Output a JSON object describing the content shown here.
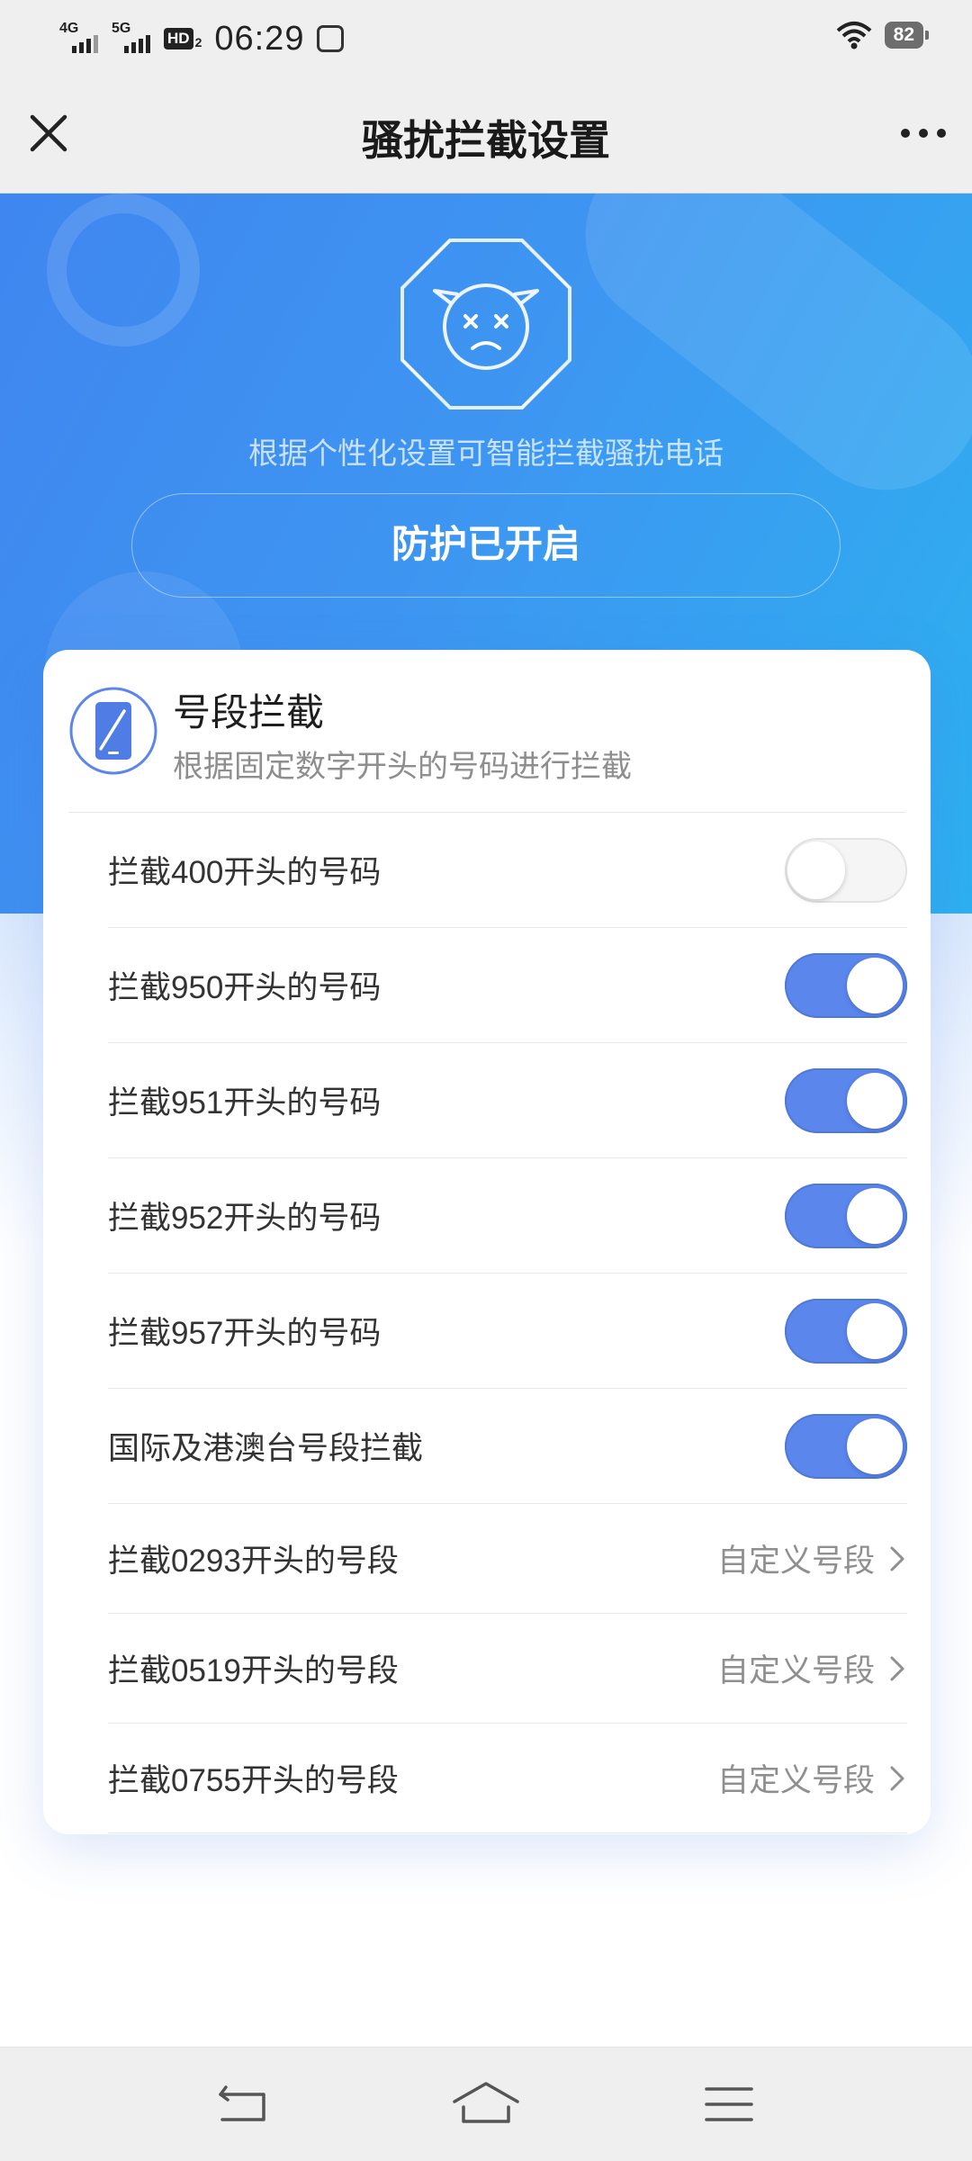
{
  "status_bar": {
    "network_1": "4G",
    "network_2": "5G",
    "hd_badge": "HD",
    "hd_sub": "2",
    "time": "06:29",
    "battery": "82"
  },
  "header": {
    "title": "骚扰拦截设置"
  },
  "hero": {
    "description": "根据个性化设置可智能拦截骚扰电话",
    "status_button": "防护已开启"
  },
  "card": {
    "title": "号段拦截",
    "subtitle": "根据固定数字开头的号码进行拦截",
    "toggle_rows": [
      {
        "label": "拦截400开头的号码",
        "enabled": false
      },
      {
        "label": "拦截950开头的号码",
        "enabled": true
      },
      {
        "label": "拦截951开头的号码",
        "enabled": true
      },
      {
        "label": "拦截952开头的号码",
        "enabled": true
      },
      {
        "label": "拦截957开头的号码",
        "enabled": true
      },
      {
        "label": "国际及港澳台号段拦截",
        "enabled": true
      }
    ],
    "link_rows": [
      {
        "label": "拦截0293开头的号段",
        "action": "自定义号段"
      },
      {
        "label": "拦截0519开头的号段",
        "action": "自定义号段"
      },
      {
        "label": "拦截0755开头的号段",
        "action": "自定义号段"
      }
    ]
  },
  "colors": {
    "hero_gradient_start": "#3f86f0",
    "hero_gradient_end": "#2db0f0",
    "toggle_on": "#5b86ec",
    "icon_outline": "#5b86ec"
  },
  "icons": {
    "close": "close-icon",
    "more": "more-dots-icon",
    "emblem": "angry-devil-octagon-icon",
    "card": "phone-blocked-icon",
    "chevron": "chevron-right-icon",
    "nav_back": "back-icon",
    "nav_home": "home-icon",
    "nav_menu": "menu-icon"
  }
}
